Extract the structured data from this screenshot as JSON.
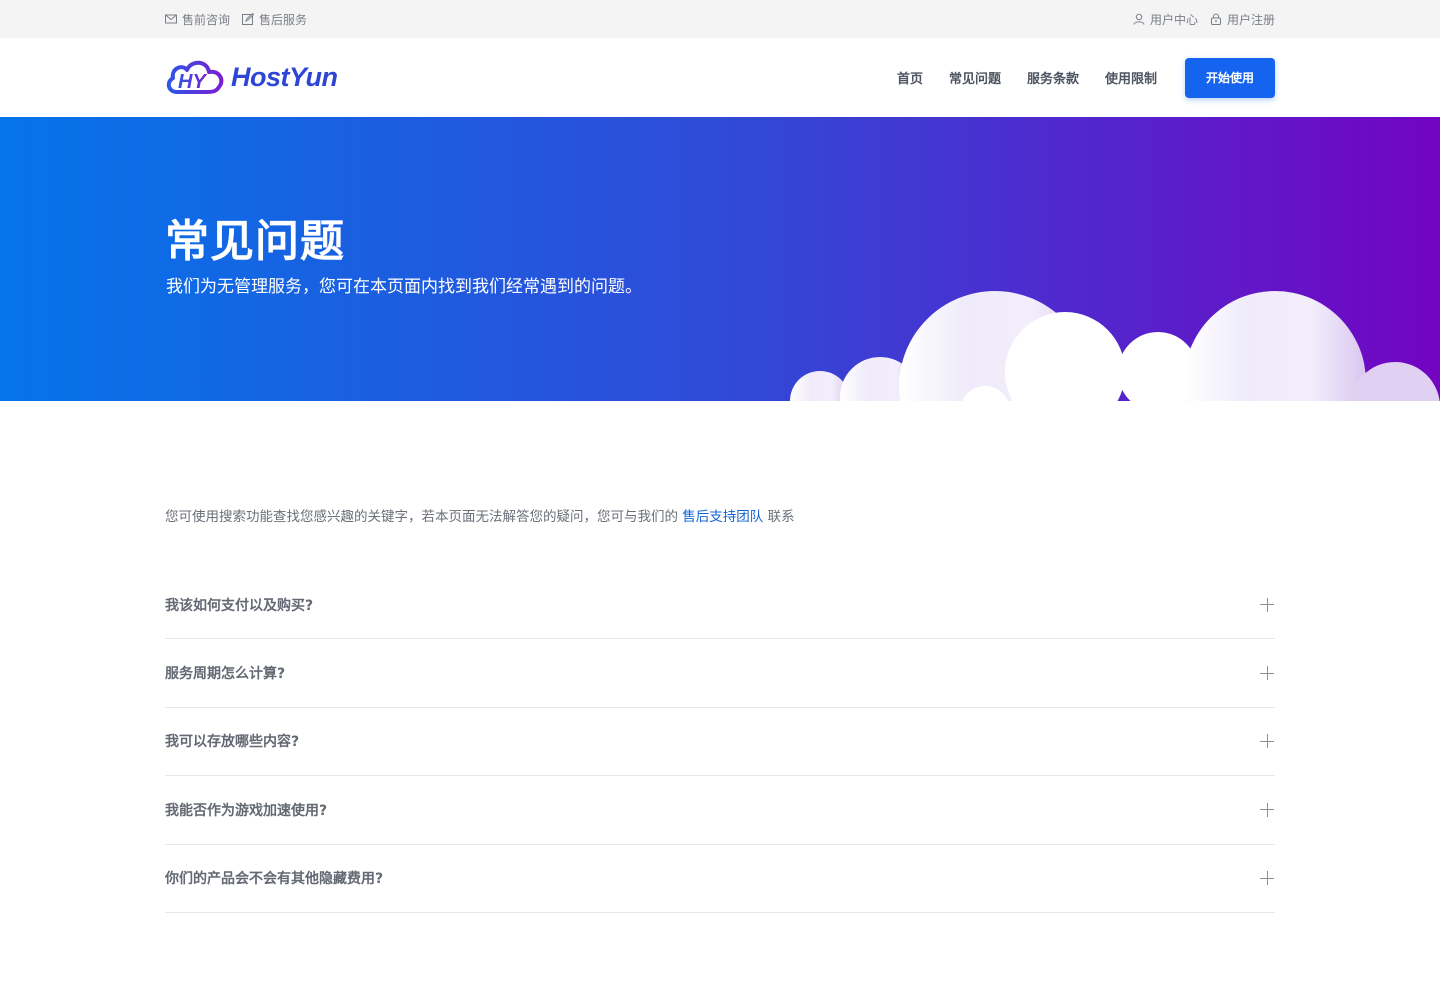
{
  "topbar": {
    "left": [
      {
        "icon": "mail-icon",
        "label": "售前咨询"
      },
      {
        "icon": "edit-icon",
        "label": "售后服务"
      }
    ],
    "right": [
      {
        "icon": "user-icon",
        "label": "用户中心"
      },
      {
        "icon": "lock-icon",
        "label": "用户注册"
      }
    ]
  },
  "header": {
    "logo_text": "HostYun",
    "nav": [
      "首页",
      "常见问题",
      "服务条款",
      "使用限制"
    ],
    "cta_label": "开始使用"
  },
  "hero": {
    "title": "常见问题",
    "subtitle": "我们为无管理服务，您可在本页面内找到我们经常遇到的问题。"
  },
  "intro": {
    "text_before": "您可使用搜索功能查找您感兴趣的关键字，若本页面无法解答您的疑问，您可与我们的 ",
    "link": "售后支持团队",
    "text_after": " 联系"
  },
  "faq": [
    "我该如何支付以及购买?",
    "服务周期怎么计算?",
    "我可以存放哪些内容?",
    "我能否作为游戏加速使用?",
    "你们的产品会不会有其他隐藏费用?"
  ],
  "colors": {
    "brand": "#2d46d6",
    "cta": "#1464f0",
    "hero_start": "#0574ea",
    "hero_end": "#7304c2",
    "link": "#1464d8"
  }
}
